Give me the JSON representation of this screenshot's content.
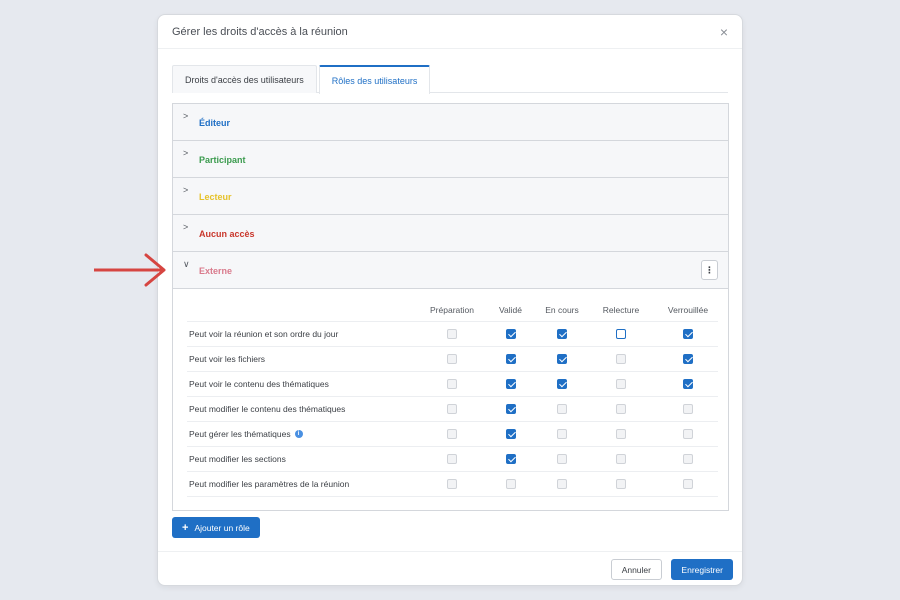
{
  "modal": {
    "title": "Gérer les droits d'accès à la réunion",
    "close_icon": "×"
  },
  "tabs": [
    {
      "label": "Droits d'accès des utilisateurs",
      "active": false
    },
    {
      "label": "Rôles des utilisateurs",
      "active": true
    }
  ],
  "roles": [
    {
      "label": "Éditeur",
      "color": "#1f6fc5",
      "expanded": false
    },
    {
      "label": "Participant",
      "color": "#3b9b4e",
      "expanded": false
    },
    {
      "label": "Lecteur",
      "color": "#e6c229",
      "expanded": false
    },
    {
      "label": "Aucun accès",
      "color": "#c9372c",
      "expanded": false
    },
    {
      "label": "Externe",
      "color": "#d97a8c",
      "expanded": true
    }
  ],
  "chevron_collapsed": ">",
  "chevron_expanded": "∨",
  "kebab_icon": "⋮",
  "permissions": {
    "columns": [
      "Préparation",
      "Validé",
      "En cours",
      "Relecture",
      "Verrouillée"
    ],
    "rows": [
      {
        "label": "Peut voir la réunion et son ordre du jour",
        "info": false,
        "states": [
          "off",
          "on",
          "on",
          "outline",
          "on"
        ]
      },
      {
        "label": "Peut voir les fichiers",
        "info": false,
        "states": [
          "off",
          "on",
          "on",
          "off",
          "on"
        ]
      },
      {
        "label": "Peut voir le contenu des thématiques",
        "info": false,
        "states": [
          "off",
          "on",
          "on",
          "off",
          "on"
        ]
      },
      {
        "label": "Peut modifier le contenu des thématiques",
        "info": false,
        "states": [
          "off",
          "on",
          "off",
          "off",
          "off"
        ]
      },
      {
        "label": "Peut gérer les thématiques",
        "info": true,
        "states": [
          "off",
          "on",
          "off",
          "off",
          "off"
        ]
      },
      {
        "label": "Peut modifier les sections",
        "info": false,
        "states": [
          "off",
          "on",
          "off",
          "off",
          "off"
        ]
      },
      {
        "label": "Peut modifier les paramètres de la réunion",
        "info": false,
        "states": [
          "off",
          "off",
          "off",
          "off",
          "off"
        ]
      }
    ]
  },
  "info_icon": "i",
  "add_role": {
    "icon": "+",
    "label": "Ajouter un rôle"
  },
  "footer": {
    "cancel_label": "Annuler",
    "save_label": "Enregistrer"
  },
  "colors": {
    "accent": "#1f6fc5",
    "arrow": "#d64541"
  }
}
